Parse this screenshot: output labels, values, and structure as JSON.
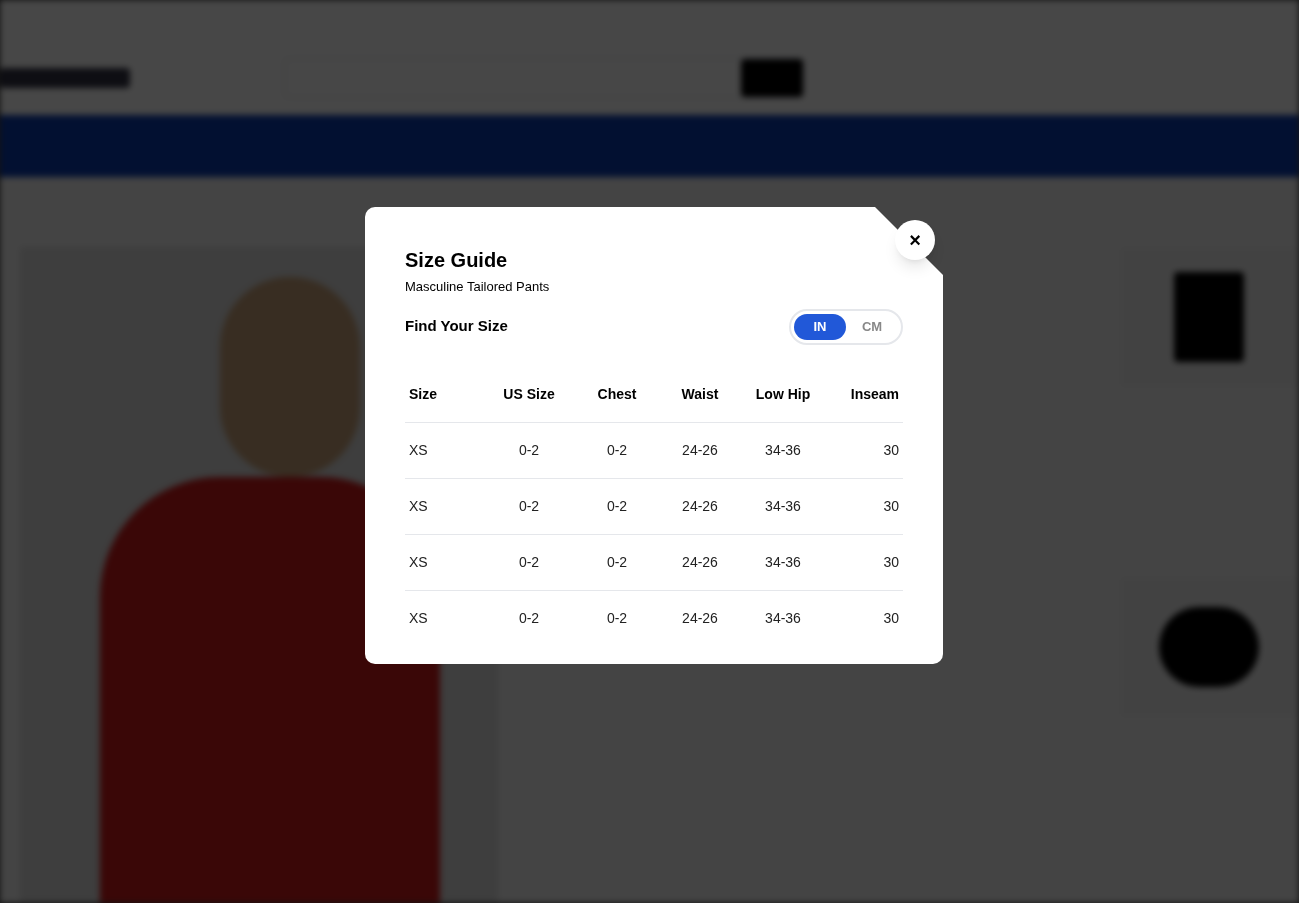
{
  "modal": {
    "title": "Size Guide",
    "subtitle": "Masculine Tailored Pants",
    "find_label": "Find Your Size",
    "close": "×",
    "units": [
      {
        "label": "IN",
        "selected": true
      },
      {
        "label": "CM",
        "selected": false
      }
    ],
    "table": {
      "columns": [
        "Size",
        "US Size",
        "Chest",
        "Waist",
        "Low Hip",
        "Inseam"
      ],
      "rows": [
        [
          "XS",
          "0-2",
          "0-2",
          "24-26",
          "34-36",
          "30"
        ],
        [
          "XS",
          "0-2",
          "0-2",
          "24-26",
          "34-36",
          "30"
        ],
        [
          "XS",
          "0-2",
          "0-2",
          "24-26",
          "34-36",
          "30"
        ],
        [
          "XS",
          "0-2",
          "0-2",
          "24-26",
          "34-36",
          "30"
        ]
      ]
    }
  }
}
